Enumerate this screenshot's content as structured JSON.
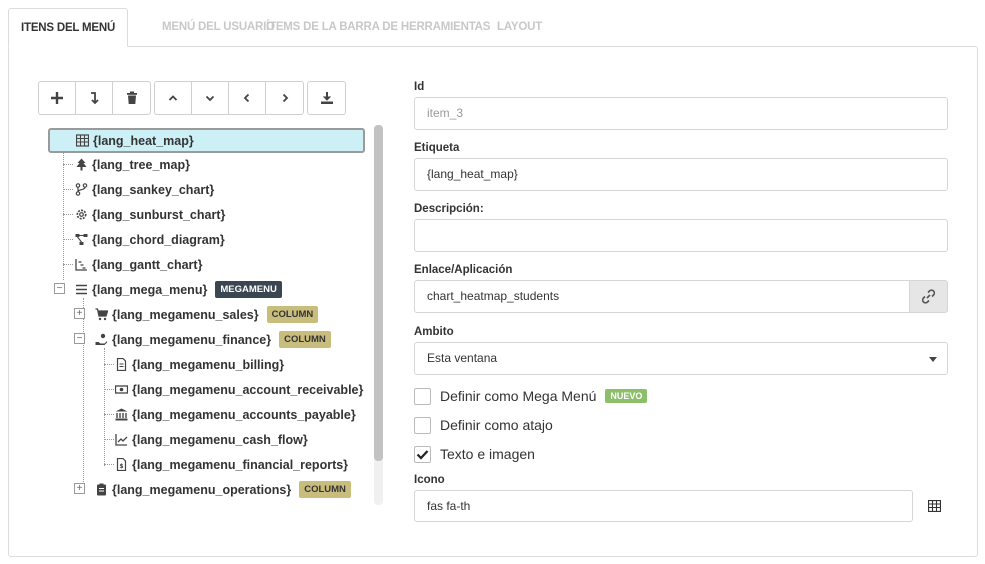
{
  "tabs": [
    {
      "label": "ITENS DEL MENÚ",
      "active": true
    },
    {
      "label": "MENÚ DEL USUARIO",
      "active": false
    },
    {
      "label": "ÍTEMS DE LA BARRA DE HERRAMIENTAS",
      "active": false
    },
    {
      "label": "LAYOUT",
      "active": false
    }
  ],
  "toolbar": {
    "group1": [
      "plus-icon",
      "move-down-icon",
      "trash-icon"
    ],
    "group2": [
      "chevron-up-icon",
      "chevron-down-icon",
      "chevron-left-icon",
      "chevron-right-icon"
    ],
    "group3": [
      "download-icon"
    ]
  },
  "tree": {
    "items": [
      {
        "label": "{lang_heat_map}",
        "icon": "table-icon",
        "selected": true
      },
      {
        "label": "{lang_tree_map}",
        "icon": "tree-icon"
      },
      {
        "label": "{lang_sankey_chart}",
        "icon": "code-branch-icon"
      },
      {
        "label": "{lang_sunburst_chart}",
        "icon": "cog-icon"
      },
      {
        "label": "{lang_chord_diagram}",
        "icon": "project-diagram-icon"
      },
      {
        "label": "{lang_gantt_chart}",
        "icon": "chart-line-icon"
      },
      {
        "label": "{lang_mega_menu}",
        "icon": "bars-icon",
        "badge": "MEGAMENU",
        "expanded": true
      },
      {
        "label": "{lang_megamenu_sales}",
        "icon": "cart-icon",
        "badge": "COLUMN",
        "expanded": false
      },
      {
        "label": "{lang_megamenu_finance}",
        "icon": "hand-coin-icon",
        "badge": "COLUMN",
        "expanded": true
      },
      {
        "label": "{lang_megamenu_billing}",
        "icon": "file-icon"
      },
      {
        "label": "{lang_megamenu_account_receivable}",
        "icon": "money-bill-icon"
      },
      {
        "label": "{lang_megamenu_accounts_payable}",
        "icon": "bank-icon"
      },
      {
        "label": "{lang_megamenu_cash_flow}",
        "icon": "chart-line-icon"
      },
      {
        "label": "{lang_megamenu_financial_reports}",
        "icon": "file-invoice-icon"
      },
      {
        "label": "{lang_megamenu_operations}",
        "icon": "clipboard-icon",
        "badge": "COLUMN",
        "expanded": false
      }
    ]
  },
  "form": {
    "id_label": "Id",
    "id_value": "item_3",
    "etiqueta_label": "Etiqueta",
    "etiqueta_value": "{lang_heat_map}",
    "descripcion_label": "Descripción:",
    "descripcion_value": "",
    "enlace_label": "Enlace/Aplicación",
    "enlace_value": "chart_heatmap_students",
    "ambito_label": "Ambito",
    "ambito_value": "Esta ventana",
    "mega_label": "Definir como Mega Menú",
    "mega_badge": "NUEVO",
    "mega_checked": false,
    "atajo_label": "Definir como atajo",
    "atajo_checked": false,
    "texto_label": "Texto e imagen",
    "texto_checked": true,
    "icono_label": "Icono",
    "icono_value": "fas fa-th"
  },
  "colors": {
    "selected_bg": "#cdf0f6",
    "badge_dark": "#3a4651",
    "badge_olive": "#c9bd7e",
    "badge_green": "#8dbf6b"
  }
}
